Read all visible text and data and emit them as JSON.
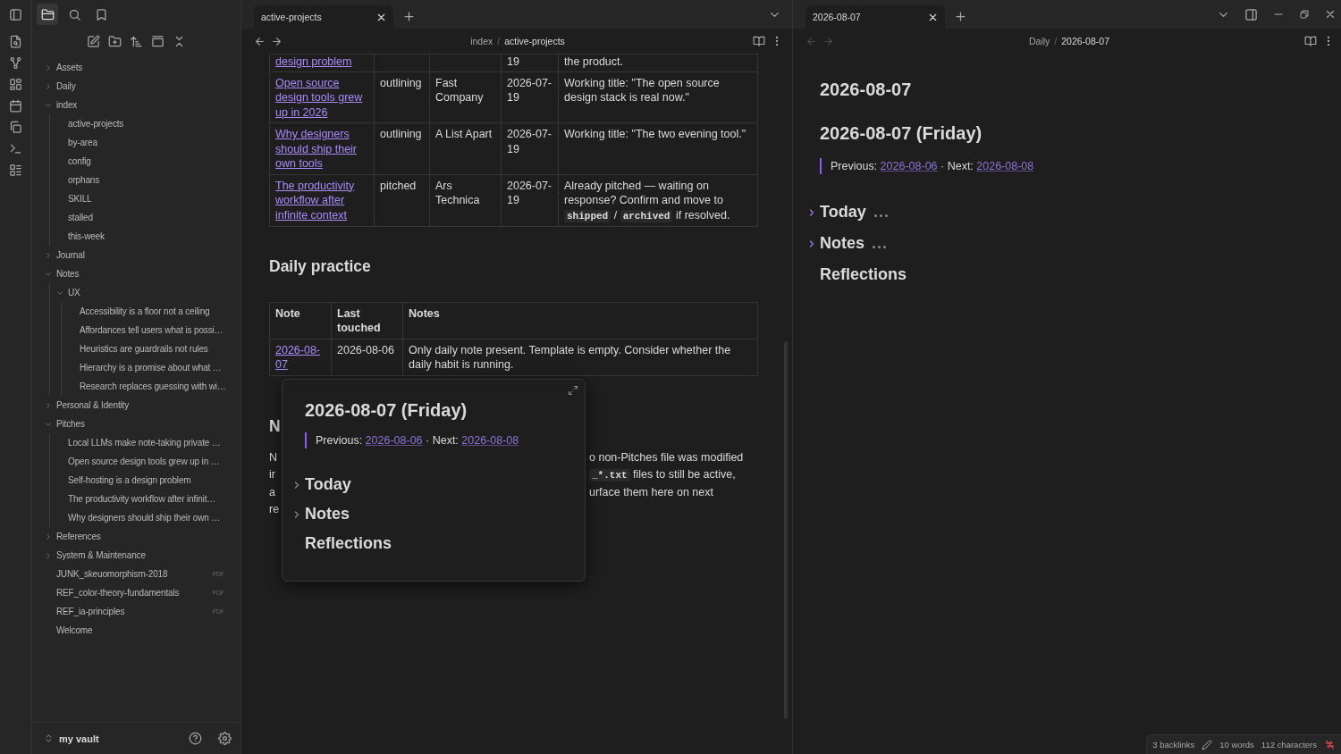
{
  "sidebar": {
    "tabs": [
      {
        "kind": "files",
        "selected": true
      },
      {
        "kind": "search",
        "selected": false
      },
      {
        "kind": "bookmarks",
        "selected": false
      }
    ],
    "file_tree": [
      {
        "label": "Assets",
        "kind": "folder",
        "expanded": false
      },
      {
        "label": "Daily",
        "kind": "folder",
        "expanded": false
      },
      {
        "label": "index",
        "kind": "folder",
        "expanded": true,
        "children": [
          {
            "label": "active-projects",
            "kind": "file"
          },
          {
            "label": "by-area",
            "kind": "file"
          },
          {
            "label": "config",
            "kind": "file"
          },
          {
            "label": "orphans",
            "kind": "file"
          },
          {
            "label": "SKILL",
            "kind": "file"
          },
          {
            "label": "stalled",
            "kind": "file"
          },
          {
            "label": "this-week",
            "kind": "file"
          }
        ]
      },
      {
        "label": "Journal",
        "kind": "folder",
        "expanded": false
      },
      {
        "label": "Notes",
        "kind": "folder",
        "expanded": true,
        "children": [
          {
            "label": "UX",
            "kind": "folder",
            "expanded": true,
            "children": [
              {
                "label": "Accessibility is a floor not a ceiling",
                "kind": "file"
              },
              {
                "label": "Affordances tell users what is possi…",
                "kind": "file"
              },
              {
                "label": "Heuristics are guardrails not rules",
                "kind": "file"
              },
              {
                "label": "Hierarchy is a promise about what …",
                "kind": "file"
              },
              {
                "label": "Research replaces guessing with wi…",
                "kind": "file"
              }
            ]
          }
        ]
      },
      {
        "label": "Personal & Identity",
        "kind": "folder",
        "expanded": false
      },
      {
        "label": "Pitches",
        "kind": "folder",
        "expanded": true,
        "children": [
          {
            "label": "Local LLMs make note-taking private …",
            "kind": "file"
          },
          {
            "label": "Open source design tools grew up in …",
            "kind": "file"
          },
          {
            "label": "Self-hosting is a design problem",
            "kind": "file"
          },
          {
            "label": "The productivity workflow after infinit…",
            "kind": "file"
          },
          {
            "label": "Why designers should ship their own …",
            "kind": "file"
          }
        ]
      },
      {
        "label": "References",
        "kind": "folder",
        "expanded": false
      },
      {
        "label": "System & Maintenance",
        "kind": "folder",
        "expanded": false
      },
      {
        "label": "JUNK_skeuomorphism-2018",
        "kind": "file",
        "badge": "PDF"
      },
      {
        "label": "REF_color-theory-fundamentals",
        "kind": "file",
        "badge": "PDF"
      },
      {
        "label": "REF_ia-principles",
        "kind": "file",
        "badge": "PDF"
      },
      {
        "label": "Welcome",
        "kind": "file"
      }
    ],
    "vault": "my vault"
  },
  "left_pane": {
    "tab": {
      "title": "active-projects",
      "selected": true
    },
    "nav": {
      "back_disabled": false,
      "forward_disabled": false
    },
    "breadcrumb": {
      "parts": [
        "index",
        "active-projects"
      ],
      "separator": "/"
    },
    "pitches_table": {
      "rows": [
        {
          "column_1": "design problem",
          "column_4": "19",
          "column_5": [
            {
              "kind": "text",
              "text": "the product."
            }
          ]
        },
        {
          "column_1": "Open source design tools grew up in 2026",
          "column_2": "outlining",
          "column_3": "Fast Company",
          "column_4": "2026-07-19",
          "column_5": [
            {
              "kind": "text",
              "text": "Working title: \"The open source design stack is real now.\""
            }
          ]
        },
        {
          "column_1": "Why designers should ship their own tools",
          "column_2": "outlining",
          "column_3": "A List Apart",
          "column_4": "2026-07-19",
          "column_5": [
            {
              "kind": "text",
              "text": "Working title: \"The two evening tool.\""
            }
          ]
        },
        {
          "column_1": "The productivity workflow after infinite context",
          "column_2": "pitched",
          "column_3": "Ars Technica",
          "column_4": "2026-07-19",
          "column_5": [
            {
              "kind": "text",
              "text": "Already pitched — waiting on response? Confirm and move to "
            },
            {
              "kind": "code",
              "text": "shipped"
            },
            {
              "kind": "text",
              "text": " / "
            },
            {
              "kind": "code",
              "text": "archived"
            },
            {
              "kind": "text",
              "text": " if resolved."
            }
          ]
        }
      ]
    },
    "daily_practice": {
      "heading": "Daily practice",
      "columns": [
        "Note",
        "Last touched",
        "Notes"
      ],
      "rows": [
        {
          "note": "2026-08-07",
          "last_touched": "2026-08-06",
          "notes": "Only daily note present. Template is empty. Consider whether the daily habit is running."
        }
      ]
    },
    "covered_section": {
      "heading": "N",
      "lines": [
        {
          "left": "N",
          "right": [
            {
              "kind": "text",
              "text": "o non-Pitches file was modified"
            }
          ]
        },
        {
          "left": "ir",
          "right": [
            {
              "kind": "code",
              "text": "_*.txt"
            },
            {
              "kind": "text",
              "text": " files to still be active,"
            }
          ]
        },
        {
          "left": "a",
          "right": [
            {
              "kind": "text",
              "text": "urface them here on next"
            }
          ]
        },
        {
          "left": "re"
        }
      ]
    },
    "hover_preview": {
      "title": "2026-08-07 (Friday)",
      "nav_line": {
        "before": "Previous:",
        "previous": "2026-08-06",
        "middle": "· Next:",
        "next": "2026-08-08"
      },
      "headings": [
        {
          "text": "Today",
          "foldable": true,
          "collapsed": false
        },
        {
          "text": "Notes",
          "foldable": true,
          "collapsed": false
        },
        {
          "text": "Reflections",
          "foldable": false,
          "collapsed": false
        }
      ]
    }
  },
  "right_pane": {
    "tab": {
      "title": "2026-08-07",
      "selected": true
    },
    "nav": {
      "back_disabled": true,
      "forward_disabled": true
    },
    "breadcrumb": {
      "parts": [
        "Daily",
        "2026-08-07"
      ],
      "separator": "/"
    },
    "title": "2026-08-07",
    "heading": "2026-08-07 (Friday)",
    "nav_line": {
      "before": "Previous:",
      "previous": "2026-08-06",
      "middle": "· Next:",
      "next": "2026-08-08"
    },
    "headings": [
      {
        "text": "Today",
        "foldable": true,
        "collapsed": true
      },
      {
        "text": "Notes",
        "foldable": true,
        "collapsed": true
      },
      {
        "text": "Reflections",
        "foldable": false,
        "collapsed": false
      }
    ]
  },
  "status_bar": {
    "backlinks": "3 backlinks",
    "words": "10 words",
    "characters": "112 characters"
  }
}
